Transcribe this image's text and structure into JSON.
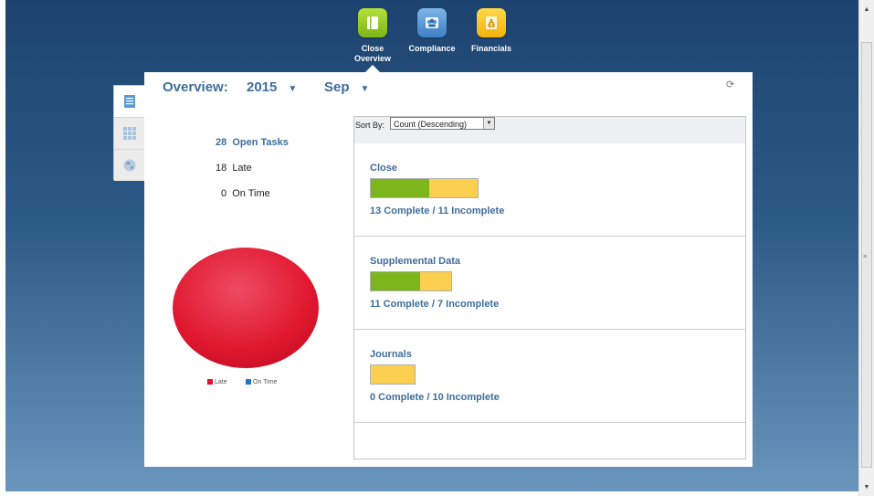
{
  "nav": [
    {
      "label_line1": "Close",
      "label_line2": "Overview",
      "icon": "book-icon",
      "color": "#8cc11f"
    },
    {
      "label_line1": "Compliance",
      "label_line2": "",
      "icon": "people-icon",
      "color": "#4a8fd3"
    },
    {
      "label_line1": "Financials",
      "label_line2": "",
      "icon": "money-bag-icon",
      "color": "#f6c01e"
    }
  ],
  "overview": {
    "title": "Overview:",
    "year": "2015",
    "month": "Sep"
  },
  "side_tabs": [
    "list-view-icon",
    "grid-view-icon",
    "globe-icon"
  ],
  "stats": {
    "open_count": "28",
    "open_label": "Open Tasks",
    "late_count": "18",
    "late_label": "Late",
    "ontime_count": "0",
    "ontime_label": "On Time"
  },
  "pie_chart": {
    "legend": [
      {
        "label": "Late",
        "color": "#e0122f"
      },
      {
        "label": "On Time",
        "color": "#1f78c8"
      }
    ],
    "slices": [
      {
        "label": "Late",
        "value": 18
      },
      {
        "label": "On Time",
        "value": 0
      }
    ]
  },
  "sort": {
    "label": "Sort By:",
    "selected": "Count (Descending)"
  },
  "groups": [
    {
      "name": "Close",
      "complete": 13,
      "incomplete": 11,
      "status": "13 Complete / 11 Incomplete"
    },
    {
      "name": "Supplemental Data",
      "complete": 11,
      "incomplete": 7,
      "status": "11 Complete / 7 Incomplete"
    },
    {
      "name": "Journals",
      "complete": 0,
      "incomplete": 10,
      "status": "0 Complete / 10 Incomplete"
    }
  ]
}
